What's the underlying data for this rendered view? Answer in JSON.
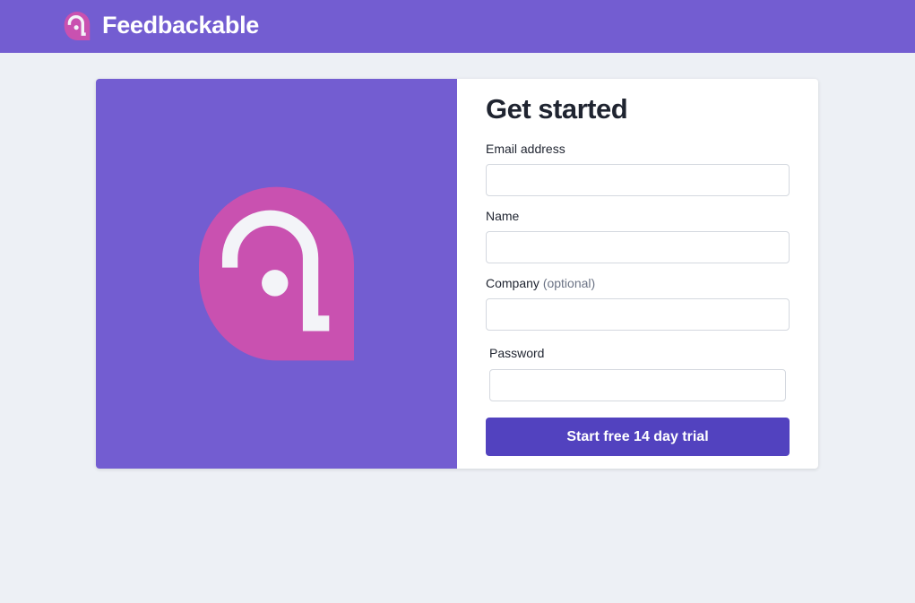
{
  "header": {
    "brand_name": "Feedbackable",
    "logo_icon": "feedbackable-logo-icon"
  },
  "hero": {
    "logo_icon": "feedbackable-logo-icon"
  },
  "form": {
    "title": "Get started",
    "email_label": "Email address",
    "email_value": "",
    "name_label": "Name",
    "name_value": "",
    "company_label": "Company",
    "company_optional": "(optional)",
    "company_value": "",
    "password_label": "Password",
    "password_value": "",
    "submit_label": "Start free 14 day trial"
  },
  "colors": {
    "brand_purple": "#735dd1",
    "logo_pink": "#c951b0",
    "button_purple": "#5242bf",
    "page_background": "#edf0f5"
  }
}
